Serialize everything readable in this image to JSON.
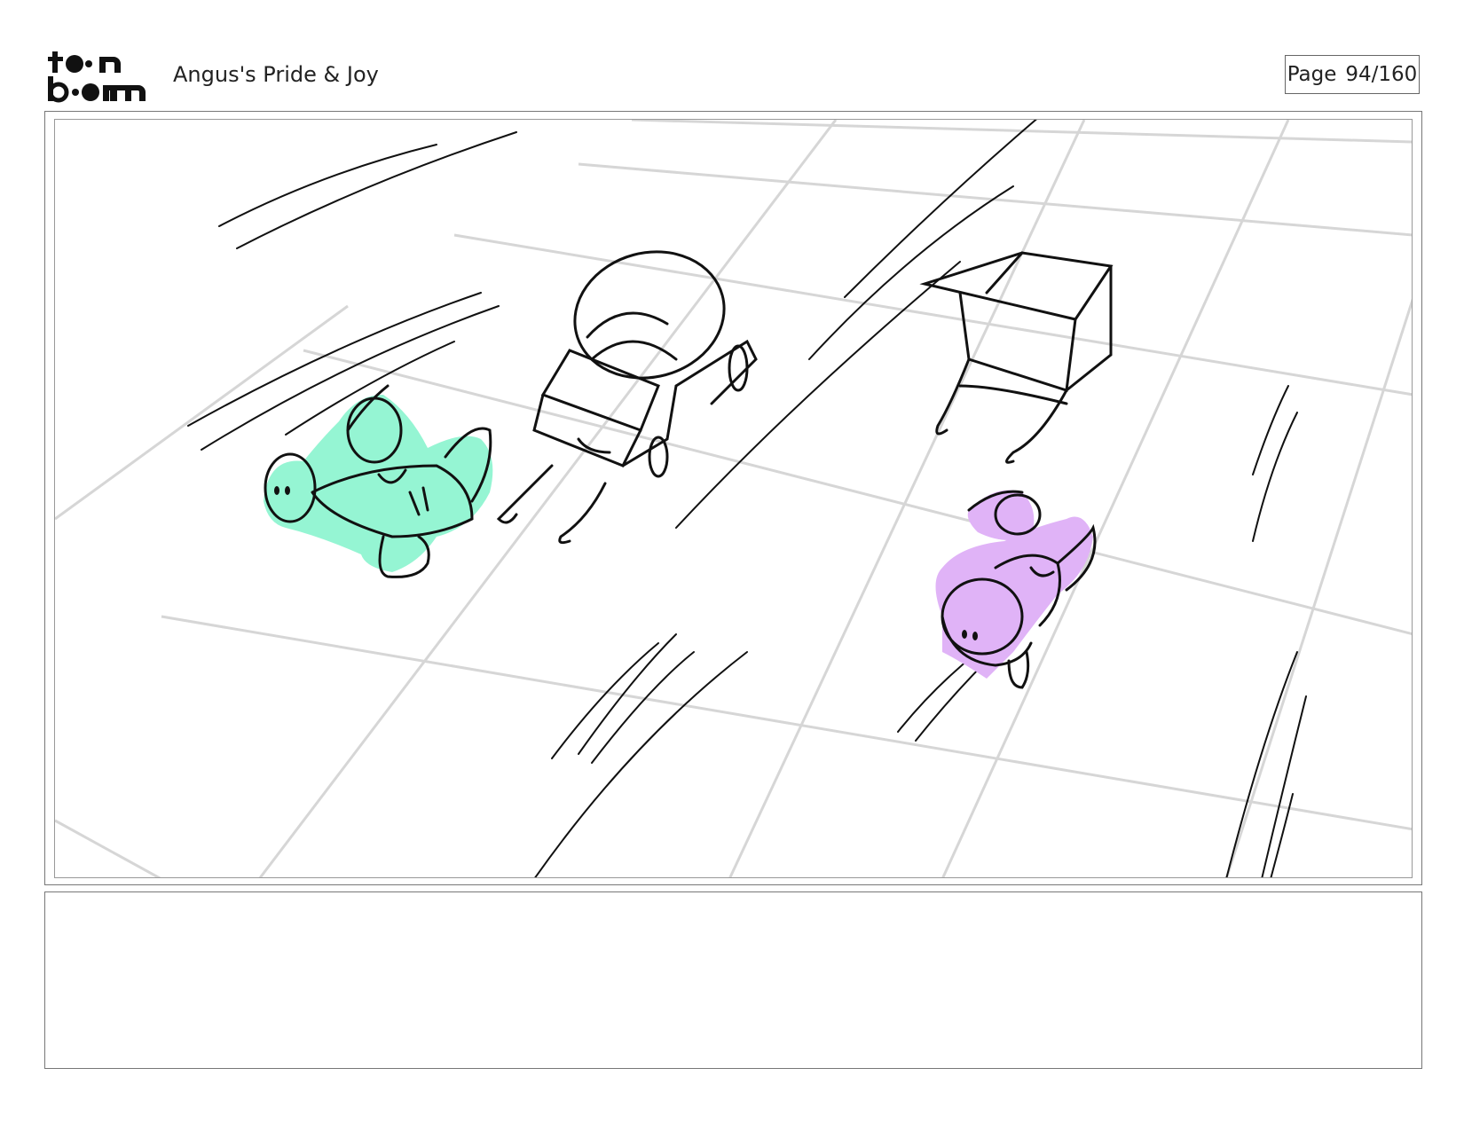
{
  "header": {
    "logo_text": "toon boom",
    "project_title": "Angus's Pride & Joy",
    "page_label": "Page",
    "page_number": "94/160"
  },
  "panel": {
    "caption": ""
  },
  "colors": {
    "green_character": "#95f5d3",
    "purple_character": "#e0b3f7",
    "grid_lines": "#d6d6d6",
    "sketch_lines": "#111111"
  }
}
